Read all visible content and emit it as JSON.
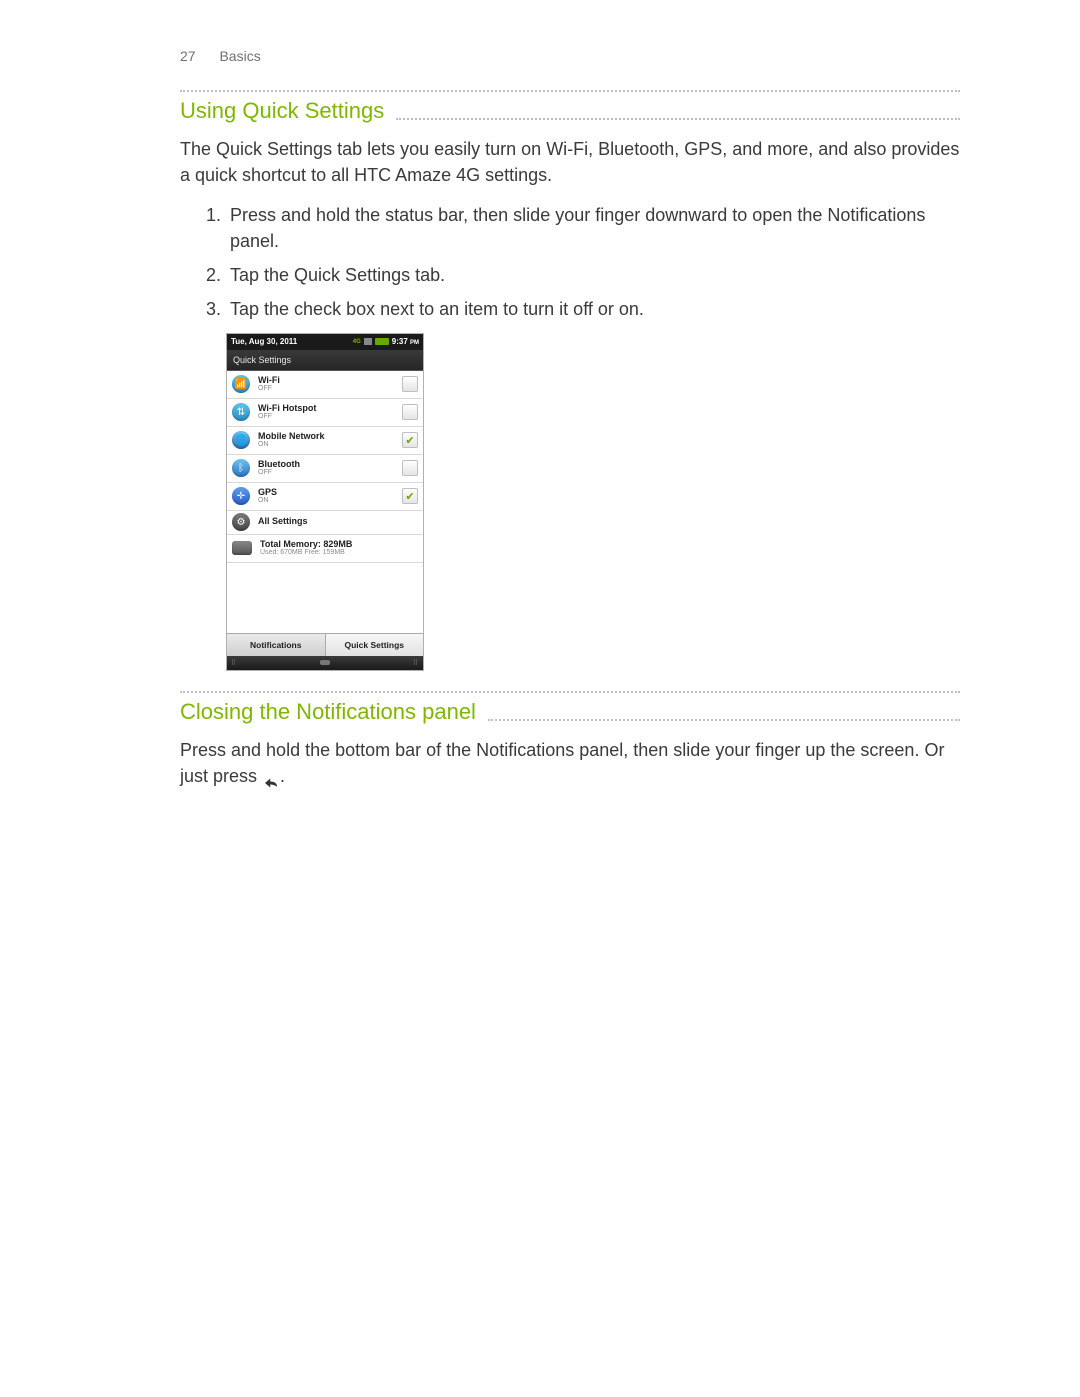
{
  "header": {
    "page_number": "27",
    "section": "Basics"
  },
  "section1": {
    "heading": "Using Quick Settings",
    "intro": "The Quick Settings tab lets you easily turn on Wi-Fi, Bluetooth, GPS, and more, and also provides a quick shortcut to all HTC Amaze 4G settings.",
    "steps": [
      "Press and hold the status bar, then slide your finger downward to open the Notifications panel.",
      "Tap the Quick Settings tab.",
      "Tap the check box next to an item to turn it off or on."
    ]
  },
  "phone": {
    "statusbar": {
      "date": "Tue, Aug 30, 2011",
      "net": "4G",
      "time": "9:37",
      "ampm": "PM"
    },
    "panel_title": "Quick Settings",
    "rows": [
      {
        "label": "Wi-Fi",
        "state": "OFF",
        "checked": false,
        "icon": "wifi"
      },
      {
        "label": "Wi-Fi Hotspot",
        "state": "OFF",
        "checked": false,
        "icon": "hot"
      },
      {
        "label": "Mobile Network",
        "state": "ON",
        "checked": true,
        "icon": "mob"
      },
      {
        "label": "Bluetooth",
        "state": "OFF",
        "checked": false,
        "icon": "bt"
      },
      {
        "label": "GPS",
        "state": "ON",
        "checked": true,
        "icon": "gps"
      }
    ],
    "all_settings": "All Settings",
    "memory_line1": "Total Memory: 829MB",
    "memory_line2": "Used: 670MB    Free: 159MB",
    "tabs": {
      "left": "Notifications",
      "right": "Quick Settings"
    }
  },
  "section2": {
    "heading": "Closing the Notifications panel",
    "body_pre": "Press and hold the bottom bar of the Notifications panel, then slide your finger up the screen. Or just press ",
    "body_post": "."
  }
}
